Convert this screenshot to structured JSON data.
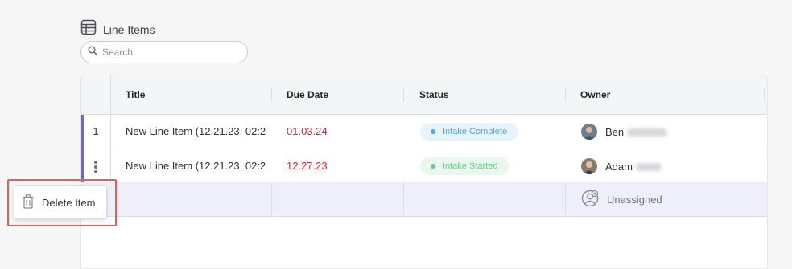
{
  "header": {
    "title": "Line Items",
    "icon": "table-icon"
  },
  "search": {
    "placeholder": "Search",
    "value": "",
    "icon": "search-icon"
  },
  "table": {
    "columns": [
      "Title",
      "Due Date",
      "Status",
      "Owner"
    ],
    "rows": [
      {
        "index": "1",
        "title": "New Line Item (12.21.23, 02:2",
        "due": "01.03.24",
        "status": {
          "label": "Intake Complete",
          "bg": "#e8f4fb",
          "dot": "#4aa8df",
          "color": "#4aa8df"
        },
        "owner": "Ben"
      },
      {
        "index": "",
        "title": "New Line Item (12.21.23, 02:2",
        "due": "12.27.23",
        "status": {
          "label": "Intake Started",
          "bg": "#e9f7ee",
          "dot": "#5fcf86",
          "color": "#5fcf86"
        },
        "owner": "Adam"
      },
      {
        "index": "",
        "title": "",
        "due": "",
        "owner": "Unassigned"
      }
    ]
  },
  "context_menu": {
    "delete_label": "Delete Item"
  },
  "colors": {
    "accent": "#6b63e6",
    "date_red": "#d6272e",
    "highlight_row": "#efeefb",
    "callout": "#ee5b4f"
  }
}
